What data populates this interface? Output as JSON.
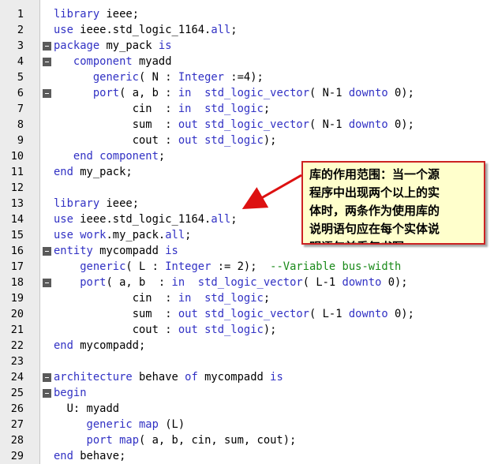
{
  "editor": {
    "lines": [
      {
        "n": "1",
        "fold": false,
        "indent": "",
        "tokens": [
          [
            "kw",
            "library"
          ],
          [
            "id",
            " ieee;"
          ]
        ]
      },
      {
        "n": "2",
        "fold": false,
        "indent": "",
        "tokens": [
          [
            "kw",
            "use"
          ],
          [
            "id",
            " ieee.std_logic_1164."
          ],
          [
            "kw",
            "all"
          ],
          [
            "id",
            ";"
          ]
        ]
      },
      {
        "n": "3",
        "fold": true,
        "indent": "",
        "tokens": [
          [
            "kw",
            "package"
          ],
          [
            "id",
            " my_pack "
          ],
          [
            "kw",
            "is"
          ]
        ]
      },
      {
        "n": "4",
        "fold": true,
        "indent": "   ",
        "tokens": [
          [
            "kw",
            "component"
          ],
          [
            "id",
            " myadd"
          ]
        ]
      },
      {
        "n": "5",
        "fold": false,
        "indent": "      ",
        "tokens": [
          [
            "kw",
            "generic"
          ],
          [
            "id",
            "( N : "
          ],
          [
            "kw",
            "Integer"
          ],
          [
            "id",
            " :=4);"
          ]
        ]
      },
      {
        "n": "6",
        "fold": true,
        "indent": "      ",
        "tokens": [
          [
            "kw",
            "port"
          ],
          [
            "id",
            "( a, b : "
          ],
          [
            "kw",
            "in"
          ],
          [
            "id",
            "  "
          ],
          [
            "kw",
            "std_logic_vector"
          ],
          [
            "id",
            "( N-1 "
          ],
          [
            "kw",
            "downto"
          ],
          [
            "id",
            " 0);"
          ]
        ]
      },
      {
        "n": "7",
        "fold": false,
        "indent": "            ",
        "tokens": [
          [
            "id",
            "cin  : "
          ],
          [
            "kw",
            "in"
          ],
          [
            "id",
            "  "
          ],
          [
            "kw",
            "std_logic"
          ],
          [
            "id",
            ";"
          ]
        ]
      },
      {
        "n": "8",
        "fold": false,
        "indent": "            ",
        "tokens": [
          [
            "id",
            "sum  : "
          ],
          [
            "kw",
            "out"
          ],
          [
            "id",
            " "
          ],
          [
            "kw",
            "std_logic_vector"
          ],
          [
            "id",
            "( N-1 "
          ],
          [
            "kw",
            "downto"
          ],
          [
            "id",
            " 0);"
          ]
        ]
      },
      {
        "n": "9",
        "fold": false,
        "indent": "            ",
        "tokens": [
          [
            "id",
            "cout : "
          ],
          [
            "kw",
            "out"
          ],
          [
            "id",
            " "
          ],
          [
            "kw",
            "std_logic"
          ],
          [
            "id",
            ");"
          ]
        ]
      },
      {
        "n": "10",
        "fold": false,
        "indent": "   ",
        "tokens": [
          [
            "kw",
            "end component"
          ],
          [
            "id",
            ";"
          ]
        ]
      },
      {
        "n": "11",
        "fold": false,
        "indent": "",
        "tokens": [
          [
            "kw",
            "end"
          ],
          [
            "id",
            " my_pack;"
          ]
        ]
      },
      {
        "n": "12",
        "fold": false,
        "indent": "",
        "tokens": []
      },
      {
        "n": "13",
        "fold": false,
        "indent": "",
        "tokens": [
          [
            "kw",
            "library"
          ],
          [
            "id",
            " ieee;"
          ]
        ]
      },
      {
        "n": "14",
        "fold": false,
        "indent": "",
        "tokens": [
          [
            "kw",
            "use"
          ],
          [
            "id",
            " ieee.std_logic_1164."
          ],
          [
            "kw",
            "all"
          ],
          [
            "id",
            ";"
          ]
        ]
      },
      {
        "n": "15",
        "fold": false,
        "indent": "",
        "tokens": [
          [
            "kw",
            "use"
          ],
          [
            "id",
            " "
          ],
          [
            "kw",
            "work"
          ],
          [
            "id",
            ".my_pack."
          ],
          [
            "kw",
            "all"
          ],
          [
            "id",
            ";"
          ]
        ]
      },
      {
        "n": "16",
        "fold": true,
        "indent": "",
        "tokens": [
          [
            "kw",
            "entity"
          ],
          [
            "id",
            " mycompadd "
          ],
          [
            "kw",
            "is"
          ]
        ]
      },
      {
        "n": "17",
        "fold": false,
        "indent": "    ",
        "tokens": [
          [
            "kw",
            "generic"
          ],
          [
            "id",
            "( L : "
          ],
          [
            "kw",
            "Integer"
          ],
          [
            "id",
            " := 2);  "
          ],
          [
            "cm",
            "--Variable bus-width"
          ]
        ]
      },
      {
        "n": "18",
        "fold": true,
        "indent": "    ",
        "tokens": [
          [
            "kw",
            "port"
          ],
          [
            "id",
            "( a, b  : "
          ],
          [
            "kw",
            "in"
          ],
          [
            "id",
            "  "
          ],
          [
            "kw",
            "std_logic_vector"
          ],
          [
            "id",
            "( L-1 "
          ],
          [
            "kw",
            "downto"
          ],
          [
            "id",
            " 0);"
          ]
        ]
      },
      {
        "n": "19",
        "fold": false,
        "indent": "            ",
        "tokens": [
          [
            "id",
            "cin  : "
          ],
          [
            "kw",
            "in"
          ],
          [
            "id",
            "  "
          ],
          [
            "kw",
            "std_logic"
          ],
          [
            "id",
            ";"
          ]
        ]
      },
      {
        "n": "20",
        "fold": false,
        "indent": "            ",
        "tokens": [
          [
            "id",
            "sum  : "
          ],
          [
            "kw",
            "out"
          ],
          [
            "id",
            " "
          ],
          [
            "kw",
            "std_logic_vector"
          ],
          [
            "id",
            "( L-1 "
          ],
          [
            "kw",
            "downto"
          ],
          [
            "id",
            " 0);"
          ]
        ]
      },
      {
        "n": "21",
        "fold": false,
        "indent": "            ",
        "tokens": [
          [
            "id",
            "cout : "
          ],
          [
            "kw",
            "out"
          ],
          [
            "id",
            " "
          ],
          [
            "kw",
            "std_logic"
          ],
          [
            "id",
            ");"
          ]
        ]
      },
      {
        "n": "22",
        "fold": false,
        "indent": "",
        "tokens": [
          [
            "kw",
            "end"
          ],
          [
            "id",
            " mycompadd;"
          ]
        ]
      },
      {
        "n": "23",
        "fold": false,
        "indent": "",
        "tokens": []
      },
      {
        "n": "24",
        "fold": true,
        "indent": "",
        "tokens": [
          [
            "kw",
            "architecture"
          ],
          [
            "id",
            " behave "
          ],
          [
            "kw",
            "of"
          ],
          [
            "id",
            " mycompadd "
          ],
          [
            "kw",
            "is"
          ]
        ]
      },
      {
        "n": "25",
        "fold": true,
        "indent": "",
        "tokens": [
          [
            "kw",
            "begin"
          ]
        ]
      },
      {
        "n": "26",
        "fold": false,
        "indent": "  ",
        "tokens": [
          [
            "id",
            "U: myadd"
          ]
        ]
      },
      {
        "n": "27",
        "fold": false,
        "indent": "     ",
        "tokens": [
          [
            "kw",
            "generic map"
          ],
          [
            "id",
            " (L)"
          ]
        ]
      },
      {
        "n": "28",
        "fold": false,
        "indent": "     ",
        "tokens": [
          [
            "kw",
            "port map"
          ],
          [
            "id",
            "( a, b, cin, sum, cout);"
          ]
        ]
      },
      {
        "n": "29",
        "fold": false,
        "indent": "",
        "tokens": [
          [
            "kw",
            "end"
          ],
          [
            "id",
            " behave;"
          ]
        ]
      }
    ]
  },
  "callout": {
    "lines": [
      "库的作用范围：当一个源",
      "程序中出现两个以上的实",
      "体时，两条作为使用库的",
      "说明语句应在每个实体说",
      "明语句前重复书写。"
    ]
  },
  "colors": {
    "keyword": "#3131c4",
    "identifier": "#000000",
    "comment": "#1a8a1a",
    "callout_border": "#cc2222",
    "callout_bg": "#ffffcc",
    "arrow": "#dd1111"
  }
}
